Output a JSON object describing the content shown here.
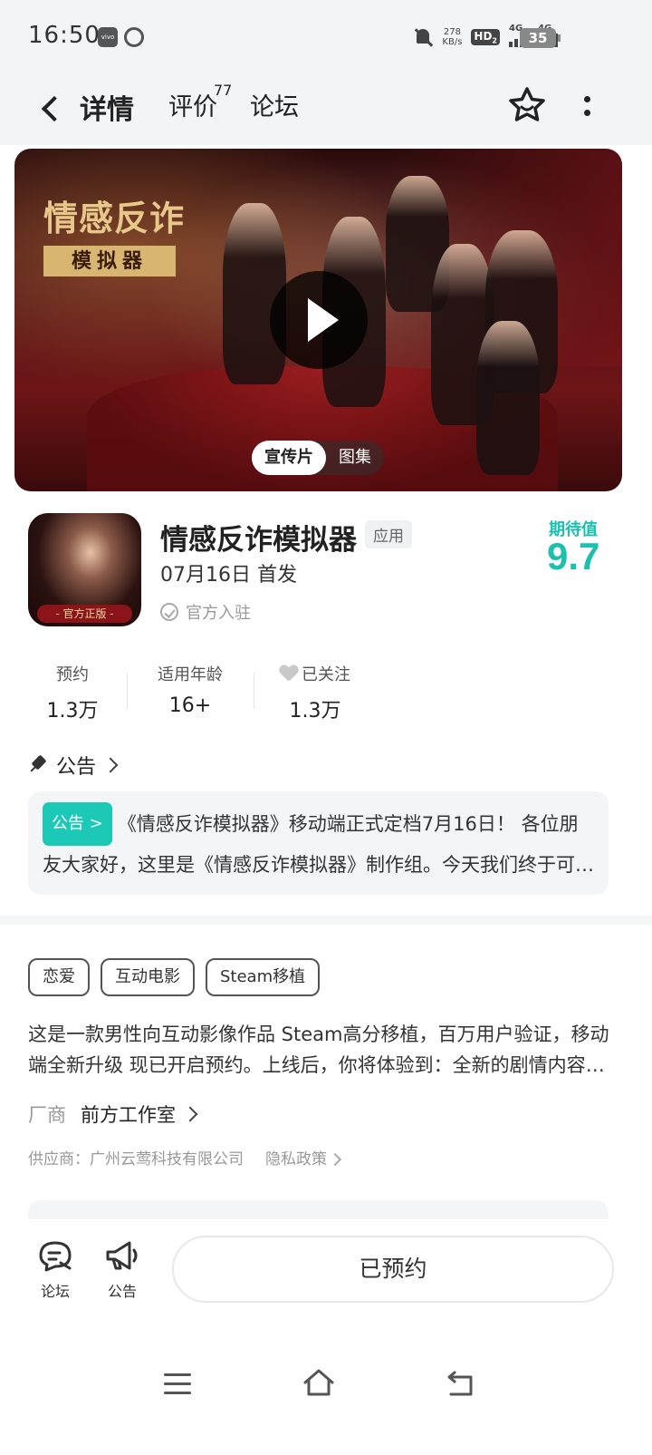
{
  "status_bar": {
    "time": "16:50",
    "net_speed_value": "278",
    "net_speed_unit": "KB/s",
    "hd_label": "HD",
    "hd_sub": "2",
    "sim1_label": "4G",
    "sim2_label": "4G",
    "battery": "35"
  },
  "header": {
    "tabs": [
      {
        "label": "详情",
        "active": true
      },
      {
        "label": "评价",
        "badge": "77"
      },
      {
        "label": "论坛"
      }
    ]
  },
  "banner": {
    "title": "情感反诈",
    "subtitle": "模拟器",
    "media_tabs": [
      {
        "label": "宣传片",
        "active": true
      },
      {
        "label": "图集"
      }
    ]
  },
  "app": {
    "icon_caption": "- 官方正版 -",
    "name": "情感反诈模拟器",
    "type_badge": "应用",
    "release": "07月16日 首发",
    "official_label": "官方入驻",
    "expect_label": "期待值",
    "expect_score": "9.7"
  },
  "stats": [
    {
      "label": "预约",
      "value": "1.3万"
    },
    {
      "label": "适用年龄",
      "value": "16+"
    },
    {
      "label": "已关注",
      "value": "1.3万"
    }
  ],
  "announcement": {
    "header": "公告",
    "badge": "公告 >",
    "text": "《情感反诈模拟器》移动端正式定档7月16日！ 各位朋友大家好，这里是《情感反诈模拟器》制作组。今天我们终于可以和大家分享这个好消息"
  },
  "tags": [
    "恋爱",
    "互动电影",
    "Steam移植"
  ],
  "description": "这是一款男性向互动影像作品 Steam高分移植，百万用户验证，移动端全新升级 现已开启预约。上线后，你将体验到：全新的剧情内容与精彩演出",
  "vendor": {
    "label": "厂商",
    "value": "前方工作室"
  },
  "supplier": {
    "text": "供应商：广州云莺科技有限公司",
    "privacy": "隐私政策"
  },
  "action_bar": {
    "forum_label": "论坛",
    "notice_label": "公告",
    "reserve_label": "已预约"
  },
  "colors": {
    "accent": "#1dd5c2",
    "score": "#1dbfae"
  }
}
